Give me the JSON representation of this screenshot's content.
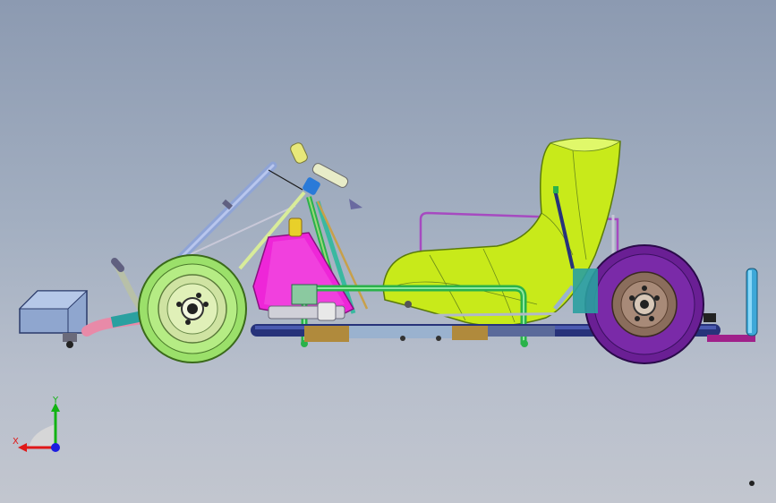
{
  "viewport": {
    "colors": {
      "bg_top": "#8c9ab1",
      "bg_bottom": "#c2c6cf"
    }
  },
  "triad": {
    "x_label": "X",
    "y_label": "Y",
    "colors": {
      "x_axis": "#e01818",
      "y_axis": "#12b312",
      "z_axis": "#1c1ce0",
      "plane": "#d8d8d8"
    }
  },
  "model": {
    "colors": {
      "seat": "#c8ea1a",
      "fuel_tank": "#ee26d8",
      "rear_wheel_tire": "#6a1f94",
      "rear_wheel_hub": "#8a6d5c",
      "front_wheel_tire": "#9be06a",
      "front_wheel_hub": "#cfe3a2",
      "frame_green": "#2ab24a",
      "frame_steel": "#9ab2cf",
      "bumper_box": "#8fa6cf",
      "steering_column": "#8fa4d6",
      "axle_navy": "#27337a",
      "exhaust_pink": "#e88aa8",
      "brass": "#b08a3c",
      "teal": "#2aa0a0",
      "cyan_tube": "#3ea8d8"
    }
  }
}
